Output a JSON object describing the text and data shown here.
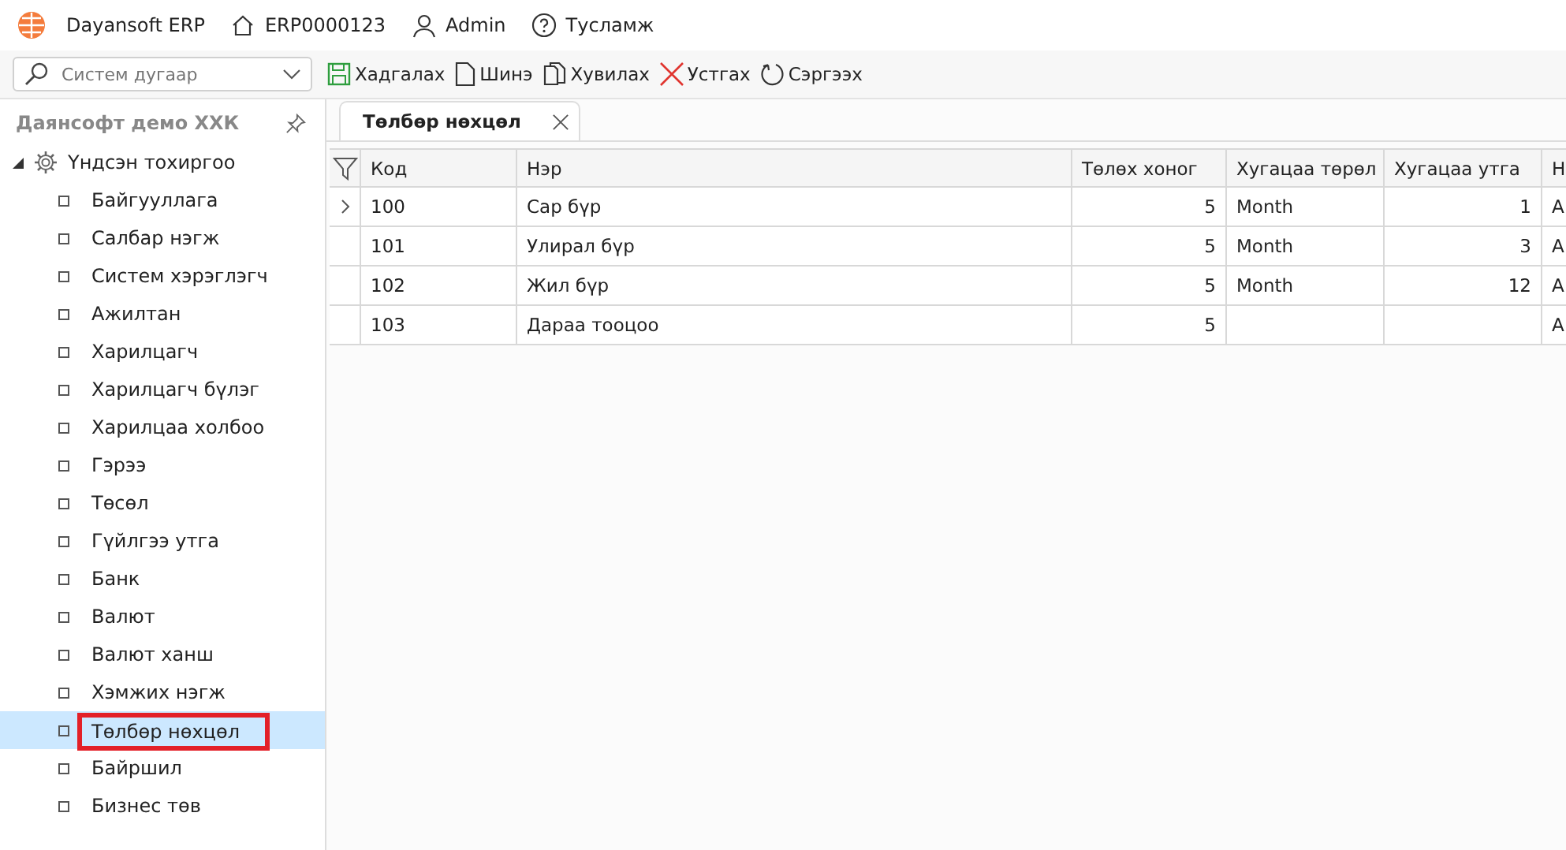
{
  "header": {
    "app_name": "Dayansoft ERP",
    "system_number": "ERP0000123",
    "user": "Admin",
    "help": "Тусламж"
  },
  "search": {
    "placeholder": "Систем дугаар"
  },
  "toolbar": [
    "Хадгалах",
    "Шинэ",
    "Хувилах",
    "Устгах",
    "Сэргээх"
  ],
  "sidebar": {
    "title": "Даянсофт демо ХХК",
    "root": {
      "label": "Үндсэн тохиргоо",
      "expanded": true,
      "children": [
        {
          "label": "Байгууллага",
          "selected": false,
          "highlighted": false
        },
        {
          "label": "Салбар нэгж",
          "selected": false,
          "highlighted": false
        },
        {
          "label": "Систем хэрэглэгч",
          "selected": false,
          "highlighted": false
        },
        {
          "label": "Ажилтан",
          "selected": false,
          "highlighted": false
        },
        {
          "label": "Харилцагч",
          "selected": false,
          "highlighted": false
        },
        {
          "label": "Харилцагч бүлэг",
          "selected": false,
          "highlighted": false
        },
        {
          "label": "Харилцаа холбоо",
          "selected": false,
          "highlighted": false
        },
        {
          "label": "Гэрээ",
          "selected": false,
          "highlighted": false
        },
        {
          "label": "Төсөл",
          "selected": false,
          "highlighted": false
        },
        {
          "label": "Гүйлгээ утга",
          "selected": false,
          "highlighted": false
        },
        {
          "label": "Банк",
          "selected": false,
          "highlighted": false
        },
        {
          "label": "Валют",
          "selected": false,
          "highlighted": false
        },
        {
          "label": "Валют ханш",
          "selected": false,
          "highlighted": false
        },
        {
          "label": "Хэмжих нэгж",
          "selected": false,
          "highlighted": false
        },
        {
          "label": "Төлбөр нөхцөл",
          "selected": true,
          "highlighted": true
        },
        {
          "label": "Байршил",
          "selected": false,
          "highlighted": false
        },
        {
          "label": "Бизнес төв",
          "selected": false,
          "highlighted": false
        }
      ]
    }
  },
  "tabs": [
    {
      "label": "Төлбөр нөхцөл",
      "selected": true
    }
  ],
  "table": {
    "columns": [
      "Код",
      "Нэр",
      "Төлөх хоног",
      "Хугацаа төрөл",
      "Хугацаа утга",
      "Н"
    ],
    "rows": [
      {
        "current": true,
        "cells": [
          "100",
          "Сар бүр",
          "5",
          "Month",
          "1",
          "А"
        ]
      },
      {
        "current": false,
        "cells": [
          "101",
          "Улирал бүр",
          "5",
          "Month",
          "3",
          "А"
        ]
      },
      {
        "current": false,
        "cells": [
          "102",
          "Жил бүр",
          "5",
          "Month",
          "12",
          "А"
        ]
      },
      {
        "current": false,
        "cells": [
          "103",
          "Дараа тооцоо",
          "5",
          "",
          "",
          "А"
        ]
      }
    ]
  }
}
